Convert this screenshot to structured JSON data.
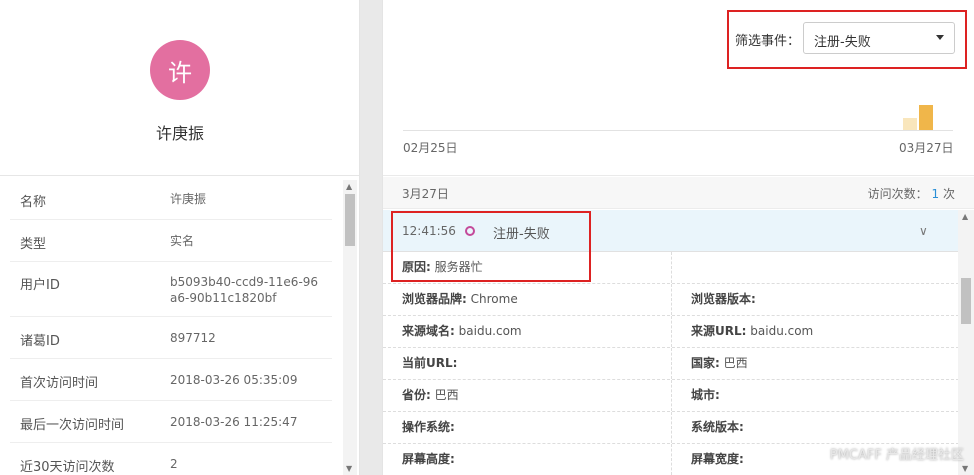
{
  "profile": {
    "avatar_char": "许",
    "name": "许庚振"
  },
  "attributes": [
    {
      "key": "名称",
      "value": "许庚振"
    },
    {
      "key": "类型",
      "value": "实名"
    },
    {
      "key": "用户ID",
      "value": "b5093b40-ccd9-11e6-96a6-90b11c1820bf"
    },
    {
      "key": "诸葛ID",
      "value": "897712"
    },
    {
      "key": "首次访问时间",
      "value": "2018-03-26 05:35:09"
    },
    {
      "key": "最后一次访问时间",
      "value": "2018-03-26 11:25:47"
    },
    {
      "key": "近30天访问次数",
      "value": "2"
    }
  ],
  "filter": {
    "label": "筛选事件：",
    "selected": "注册-失败"
  },
  "timeline": {
    "start_label": "02月25日",
    "end_label": "03月27日",
    "bars_color_light": "#f9e6bc",
    "bars_color_dark": "#f0b64a"
  },
  "session": {
    "date": "3月27日",
    "visits_label": "访问次数：",
    "visits_count": "1",
    "visits_suffix": "次"
  },
  "event": {
    "time": "12:41:56",
    "name": "注册-失败",
    "dot_color": "#c44a9a",
    "reason_key": "原因:",
    "reason_value": "服务器忙"
  },
  "details": [
    [
      {
        "key": "浏览器品牌:",
        "value": "Chrome"
      },
      {
        "key": "浏览器版本:",
        "value": ""
      }
    ],
    [
      {
        "key": "来源域名:",
        "value": "baidu.com"
      },
      {
        "key": "来源URL:",
        "value": "baidu.com"
      }
    ],
    [
      {
        "key": "当前URL:",
        "value": ""
      },
      {
        "key": "国家:",
        "value": "巴西"
      }
    ],
    [
      {
        "key": "省份:",
        "value": "巴西"
      },
      {
        "key": "城市:",
        "value": ""
      }
    ],
    [
      {
        "key": "操作系统:",
        "value": ""
      },
      {
        "key": "系统版本:",
        "value": ""
      }
    ],
    [
      {
        "key": "屏幕高度:",
        "value": ""
      },
      {
        "key": "屏幕宽度:",
        "value": ""
      }
    ]
  ],
  "watermark": "PMCAFF 产品经理社区"
}
